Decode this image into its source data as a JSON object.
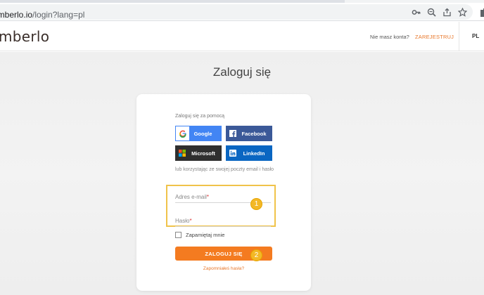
{
  "browser": {
    "url_host": "amberlo.io",
    "url_path": "/login?lang=pl",
    "icons": [
      "key-icon",
      "zoom-icon",
      "share-icon",
      "star-icon",
      "extension-icon"
    ]
  },
  "header": {
    "logo": "mberlo",
    "no_account": "Nie masz konta?",
    "register": "ZAREJESTRUJ",
    "lang": "PL"
  },
  "login": {
    "title": "Zaloguj się",
    "login_with": "Zaloguj się za pomocą",
    "social": {
      "google": "Google",
      "facebook": "Facebook",
      "microsoft": "Microsoft",
      "linkedin": "LinkedIn"
    },
    "or_email": "lub korzystając ze swojej poczty email i hasło",
    "email_placeholder": "Adres e-mail",
    "password_placeholder": "Hasło",
    "required_mark": "*",
    "remember": "Zapamiętaj mnie",
    "submit": "ZALOGUJ SIĘ",
    "forgot": "Zapomniałeś hasła?"
  },
  "annotations": {
    "badge1": "1",
    "badge2": "2"
  },
  "colors": {
    "accent": "#f47b20",
    "highlight": "#f0c34a",
    "google": "#4285f4",
    "facebook": "#3b5998",
    "microsoft": "#2f2f2f",
    "linkedin": "#0a66c2"
  }
}
